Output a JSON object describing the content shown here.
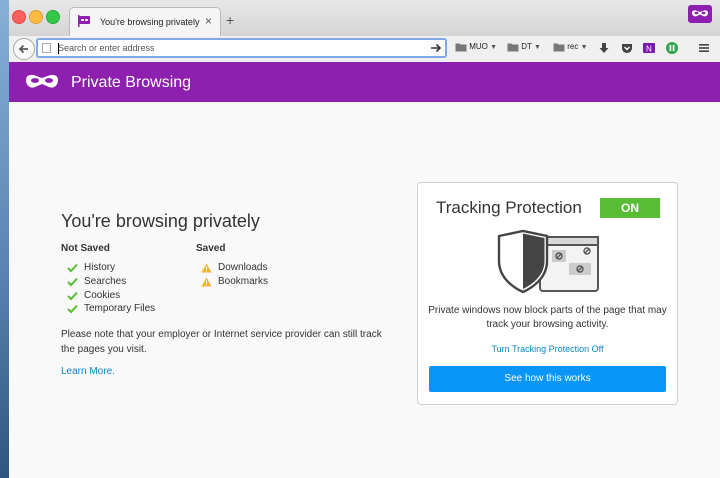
{
  "tab": {
    "title": "You're browsing privately",
    "close": "×",
    "new_tab": "+"
  },
  "urlbar": {
    "placeholder": "Search or enter address"
  },
  "bookmarks": [
    "MUO",
    "DT",
    "rec"
  ],
  "header": {
    "title": "Private Browsing"
  },
  "intro": {
    "heading": "You're browsing privately",
    "not_saved_title": "Not Saved",
    "not_saved": [
      "History",
      "Searches",
      "Cookies",
      "Temporary Files"
    ],
    "saved_title": "Saved",
    "saved": [
      "Downloads",
      "Bookmarks"
    ],
    "note": "Please note that your employer or Internet service provider can still track the pages you visit.",
    "learn_more": "Learn More."
  },
  "tracking": {
    "title": "Tracking Protection",
    "status": "ON",
    "description": "Private windows now block parts of the page that may track your browsing activity.",
    "turn_off": "Turn Tracking Protection Off",
    "button": "See how this works"
  },
  "colors": {
    "accent": "#8d20ae",
    "status_on": "#57bd35",
    "button": "#0996f8",
    "link": "#0a84c8"
  }
}
